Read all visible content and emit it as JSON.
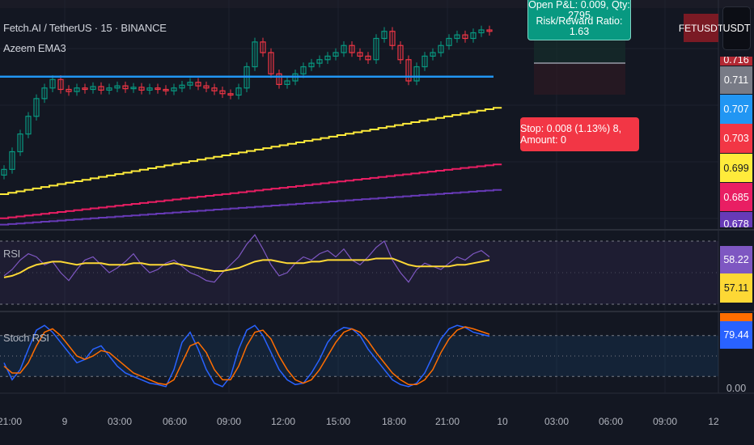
{
  "header": {
    "symbol_title": "Fetch.AI / TetherUS · 15 · BINANCE",
    "indicator": "Azeem EMA3"
  },
  "position": {
    "pnl_text": "Open P&L: 0.009, Qty: 2795",
    "rr_text": "Risk/Reward Ratio: 1.63",
    "stop_text": "Stop: 0.008 (1.13%) 8, Amount: 0"
  },
  "price_scale": {
    "symbol_badge": "FETUSDT",
    "currency": "USDT",
    "labels": [
      {
        "text": "0.716",
        "color": "#b22833"
      },
      {
        "text": "0.711",
        "color": "#787b86"
      },
      {
        "text": "0.707",
        "color": "#2196f3"
      },
      {
        "text": "0.703",
        "color": "#f23645"
      },
      {
        "text": "0.699",
        "color": "#ffeb3b"
      },
      {
        "text": "0.685",
        "color": "#e91e63"
      },
      {
        "text": "0.678",
        "color": "#673ab7"
      }
    ]
  },
  "rsi": {
    "title": "RSI",
    "value": "58.22",
    "ma_value": "57.11"
  },
  "stoch": {
    "title": "Stoch RSI",
    "k_value": "79.44",
    "zero_label": "0.00"
  },
  "time_axis": [
    "21:00",
    "9",
    "03:00",
    "06:00",
    "09:00",
    "12:00",
    "15:00",
    "18:00",
    "21:00",
    "10",
    "03:00",
    "06:00",
    "09:00",
    "12"
  ],
  "chart_data": {
    "type": "candlestick",
    "title": "Fetch.AI / TetherUS · 15 · BINANCE",
    "closes": [
      0.6985,
      0.701,
      0.7035,
      0.706,
      0.7085,
      0.71,
      0.7112,
      0.7098,
      0.7095,
      0.71,
      0.7098,
      0.7102,
      0.7097,
      0.71,
      0.7103,
      0.7099,
      0.7101,
      0.7097,
      0.71,
      0.7098,
      0.7096,
      0.71,
      0.7104,
      0.7108,
      0.7103,
      0.71,
      0.7096,
      0.7092,
      0.709,
      0.71,
      0.713,
      0.7165,
      0.715,
      0.712,
      0.7105,
      0.711,
      0.712,
      0.713,
      0.7135,
      0.714,
      0.7145,
      0.715,
      0.716,
      0.715,
      0.7145,
      0.714,
      0.717,
      0.718,
      0.716,
      0.714,
      0.711,
      0.713,
      0.7145,
      0.715,
      0.716,
      0.717,
      0.7175,
      0.717,
      0.7178,
      0.7182,
      0.718
    ],
    "horizontal_line": 0.7116,
    "ema_series": [
      {
        "name": "EMA yellow",
        "color": "#ffeb3b",
        "start": 0.695,
        "end": 0.7072
      },
      {
        "name": "EMA red",
        "color": "#e91e63",
        "start": 0.6916,
        "end": 0.6992
      },
      {
        "name": "EMA purple",
        "color": "#673ab7",
        "start": 0.6907,
        "end": 0.6956
      }
    ],
    "rsi": [
      48,
      52,
      58,
      62,
      60,
      55,
      57,
      50,
      45,
      52,
      58,
      60,
      55,
      50,
      53,
      57,
      62,
      55,
      50,
      52,
      56,
      58,
      54,
      50,
      48,
      45,
      44,
      50,
      55,
      60,
      68,
      74,
      65,
      55,
      48,
      50,
      56,
      60,
      58,
      62,
      64,
      60,
      65,
      58,
      55,
      60,
      66,
      70,
      58,
      50,
      44,
      52,
      56,
      54,
      52,
      56,
      60,
      58,
      62,
      64,
      60
    ],
    "rsi_ma": [
      47,
      48,
      50,
      53,
      55,
      56,
      57,
      57,
      56,
      55,
      56,
      56,
      56,
      55,
      55,
      55,
      56,
      56,
      55,
      55,
      55,
      56,
      55,
      54,
      53,
      52,
      51,
      51,
      52,
      53,
      55,
      57,
      58,
      58,
      57,
      56,
      56,
      56,
      57,
      57,
      58,
      58,
      58,
      58,
      58,
      58,
      59,
      59,
      59,
      57,
      55,
      54,
      54,
      54,
      54,
      54,
      55,
      55,
      56,
      57,
      58
    ],
    "stoch_k": [
      40,
      15,
      30,
      60,
      88,
      95,
      85,
      70,
      55,
      40,
      45,
      60,
      65,
      50,
      35,
      25,
      20,
      15,
      10,
      8,
      5,
      30,
      70,
      85,
      60,
      30,
      10,
      5,
      20,
      60,
      88,
      95,
      80,
      55,
      30,
      15,
      8,
      10,
      25,
      45,
      70,
      85,
      92,
      90,
      80,
      60,
      45,
      30,
      15,
      8,
      5,
      10,
      25,
      50,
      75,
      90,
      95,
      92,
      85,
      82,
      79
    ],
    "stoch_d": [
      35,
      25,
      25,
      40,
      65,
      85,
      90,
      80,
      65,
      50,
      45,
      50,
      58,
      55,
      45,
      35,
      25,
      20,
      15,
      10,
      8,
      15,
      40,
      65,
      70,
      55,
      30,
      15,
      15,
      35,
      65,
      85,
      88,
      75,
      50,
      30,
      15,
      10,
      15,
      30,
      50,
      70,
      85,
      90,
      85,
      72,
      55,
      40,
      25,
      15,
      8,
      8,
      15,
      30,
      55,
      75,
      88,
      93,
      90,
      86,
      82
    ],
    "rsi_levels": [
      70,
      30
    ],
    "stoch_levels": [
      80,
      20
    ]
  }
}
